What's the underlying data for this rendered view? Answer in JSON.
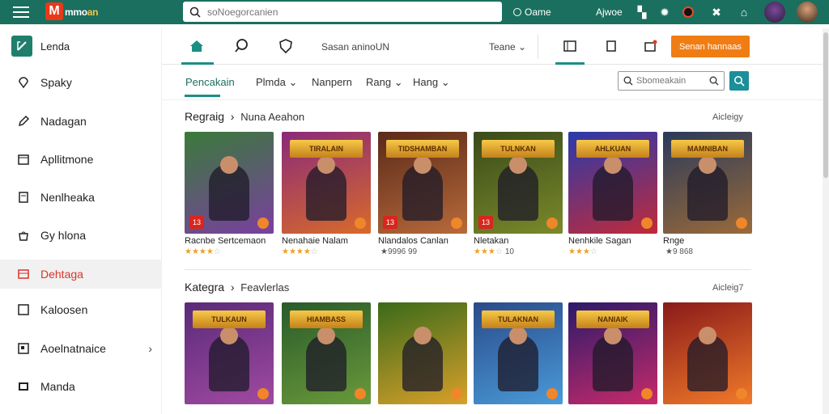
{
  "topbar": {
    "logo_letter": "M",
    "logo_text_a": "mmo",
    "logo_text_b": "an",
    "search_placeholder": "soNoegorcanien",
    "game_label": "Oame",
    "store_label": "Ajwoe",
    "icons": [
      "grid-icon",
      "gear-icon",
      "power-icon",
      "tool-icon",
      "bell-icon",
      "home-icon"
    ]
  },
  "sidebar": {
    "title": "Lenda",
    "items": [
      {
        "label": "Spaky",
        "icon": "map-pin-icon"
      },
      {
        "label": "Nadagan",
        "icon": "pen-icon"
      },
      {
        "label": "Apllitmone",
        "icon": "calendar-icon"
      },
      {
        "label": "Nenlheaka",
        "icon": "document-icon"
      },
      {
        "label": "Gy hlona",
        "icon": "bag-icon"
      },
      {
        "label": "Dehtaga",
        "icon": "list-icon"
      },
      {
        "label": "Kaloosen",
        "icon": "picture-icon"
      },
      {
        "label": "Aoelnatnaice",
        "icon": "image-icon"
      },
      {
        "label": "Manda",
        "icon": "folder-icon"
      }
    ]
  },
  "nav2": {
    "center_label": "Sasan aninoUN",
    "dropdown_label": "Teane",
    "button_label": "Senan hannaas"
  },
  "tabs": {
    "items": [
      "Pencakain",
      "Plmda",
      "Nanpern",
      "Rang",
      "Hang"
    ],
    "search_placeholder": "Sbomeakain"
  },
  "sections": [
    {
      "title": "Regraig",
      "subtitle": "Nuna Aeahon",
      "more": "Aicleigy",
      "cards": [
        {
          "name": "Racnbe Sertcemaon",
          "stars": 4,
          "rating_text": "",
          "badge": "13",
          "banner": "",
          "colors": [
            "#3a7a3a",
            "#7a3fa0"
          ]
        },
        {
          "name": "Nenahaie Nalam",
          "stars": 4,
          "rating_text": "",
          "badge": "",
          "banner": "TIRALAIN",
          "colors": [
            "#8a2a7a",
            "#d86a2a"
          ]
        },
        {
          "name": "Nlandalos Canlan",
          "stars": 0,
          "rating_text": "★9996 99",
          "badge": "13",
          "banner": "TIDSHAMBAN",
          "colors": [
            "#5a2a1a",
            "#b86a3a"
          ]
        },
        {
          "name": "Nletakan",
          "stars": 3,
          "rating_text": "10",
          "badge": "13",
          "banner": "TULNKAN",
          "colors": [
            "#3a4a1a",
            "#7a8a2a"
          ]
        },
        {
          "name": "Nenhkile Sagan",
          "stars": 3,
          "rating_text": "",
          "badge": "",
          "banner": "AHLKUAN",
          "colors": [
            "#2a3aaa",
            "#c02a3a"
          ]
        },
        {
          "name": "Rnge",
          "stars": 0,
          "rating_text": "★9 868",
          "badge": "",
          "banner": "MAMNIBAN",
          "colors": [
            "#2a3a5a",
            "#9a6a3a"
          ]
        }
      ]
    },
    {
      "title": "Kategra",
      "subtitle": "Feavlerlas",
      "more": "Aicleig7",
      "cards": [
        {
          "name": "",
          "stars": 0,
          "rating_text": "",
          "badge": "",
          "banner": "TULKAUN",
          "colors": [
            "#5a2a7a",
            "#a04aa0"
          ]
        },
        {
          "name": "",
          "stars": 0,
          "rating_text": "",
          "badge": "",
          "banner": "HIAMBASS",
          "colors": [
            "#2a5a2a",
            "#6a9a3a"
          ]
        },
        {
          "name": "",
          "stars": 0,
          "rating_text": "",
          "badge": "",
          "banner": "",
          "colors": [
            "#3a6a1a",
            "#d8a02a"
          ]
        },
        {
          "name": "",
          "stars": 0,
          "rating_text": "",
          "badge": "",
          "banner": "TULAKNAN",
          "colors": [
            "#2a4a8a",
            "#4a9ad8"
          ]
        },
        {
          "name": "",
          "stars": 0,
          "rating_text": "",
          "badge": "",
          "banner": "NANIAIK",
          "colors": [
            "#2a1a6a",
            "#c82a6a"
          ]
        },
        {
          "name": "",
          "stars": 0,
          "rating_text": "",
          "badge": "",
          "banner": "",
          "colors": [
            "#8a1a1a",
            "#f07a2a"
          ]
        }
      ]
    }
  ],
  "colors": {
    "topbar": "#1b6f5e",
    "accent": "#1b8f86",
    "active_sidebar": "#d9342b",
    "button": "#f07d14"
  }
}
